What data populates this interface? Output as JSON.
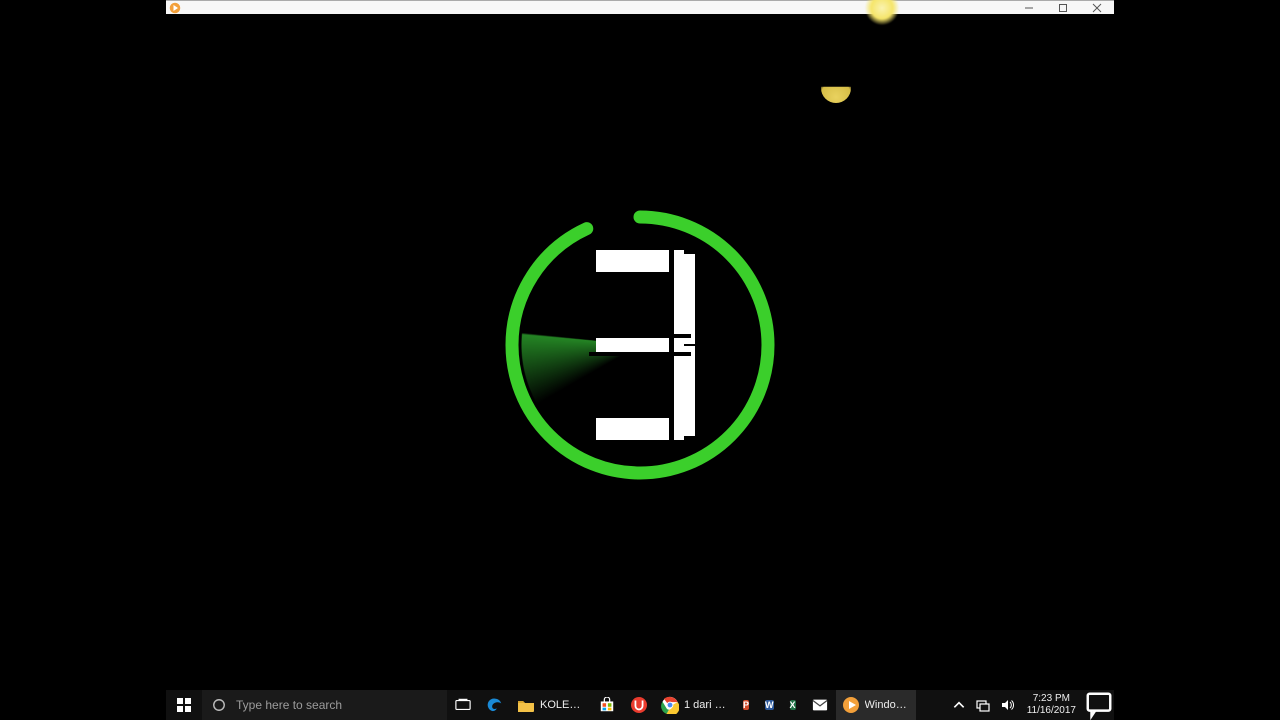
{
  "player": {
    "app_name": "Windows Media Player"
  },
  "countdown": {
    "digit": "3",
    "accent_color": "#3bcf2b"
  },
  "taskbar": {
    "search_placeholder": "Type here to search",
    "items": [
      {
        "label": "KOLEKSI ...",
        "iconColor": "#f3c147"
      },
      {
        "label": "",
        "iconColor": ""
      },
      {
        "label": "",
        "iconColor": "#e93b2e"
      },
      {
        "label": "1 dari 1 t...",
        "iconColor": ""
      },
      {
        "label": "",
        "iconColor": "#d14a2a",
        "badge": "P"
      },
      {
        "label": "",
        "iconColor": "#2a5699",
        "badge": "W"
      },
      {
        "label": "",
        "iconColor": "#1e7145",
        "badge": "X"
      },
      {
        "label": "",
        "iconColor": ""
      },
      {
        "label": "Windows...",
        "iconColor": "#f3a03a"
      }
    ]
  },
  "systray": {
    "time": "7:23 PM",
    "date": "11/16/2017"
  }
}
